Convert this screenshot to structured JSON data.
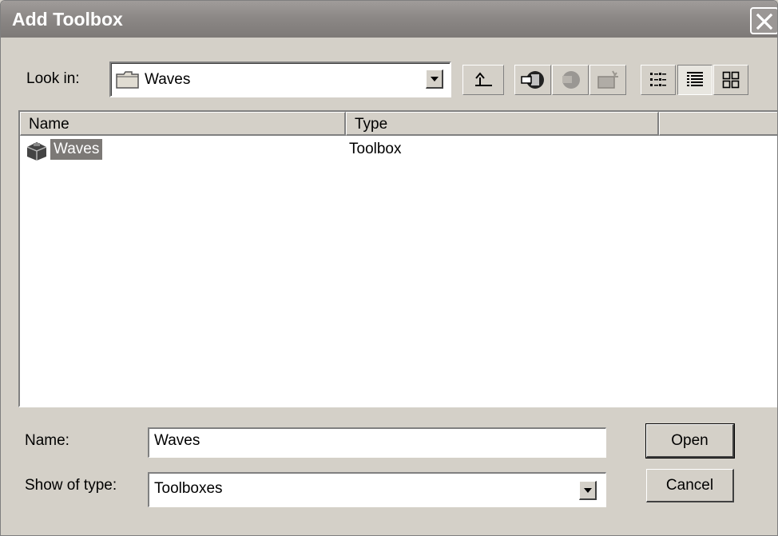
{
  "window": {
    "title": "Add Toolbox",
    "close_icon": "close-icon"
  },
  "lookin": {
    "label": "Look in:",
    "value": "Waves",
    "icon": "folder-icon"
  },
  "toolbar": {
    "icons": [
      "up-one-level-icon",
      "connect-folder-icon",
      "disconnect-folder-icon",
      "new-toolbox-icon",
      "list-view-icon",
      "details-view-icon",
      "thumbnails-view-icon"
    ],
    "active_view": "details"
  },
  "list": {
    "columns": [
      "Name",
      "Type"
    ],
    "rows": [
      {
        "name": "Waves",
        "type": "Toolbox",
        "icon": "toolbox-icon",
        "selected": true
      }
    ]
  },
  "name_field": {
    "label": "Name:",
    "value": "Waves"
  },
  "type_field": {
    "label": "Show of type:",
    "value": "Toolboxes"
  },
  "buttons": {
    "open": "Open",
    "cancel": "Cancel"
  },
  "colors": {
    "titlebar": "#8c8886",
    "dialog_bg": "#d4d0c8",
    "selection": "#7c7976"
  }
}
